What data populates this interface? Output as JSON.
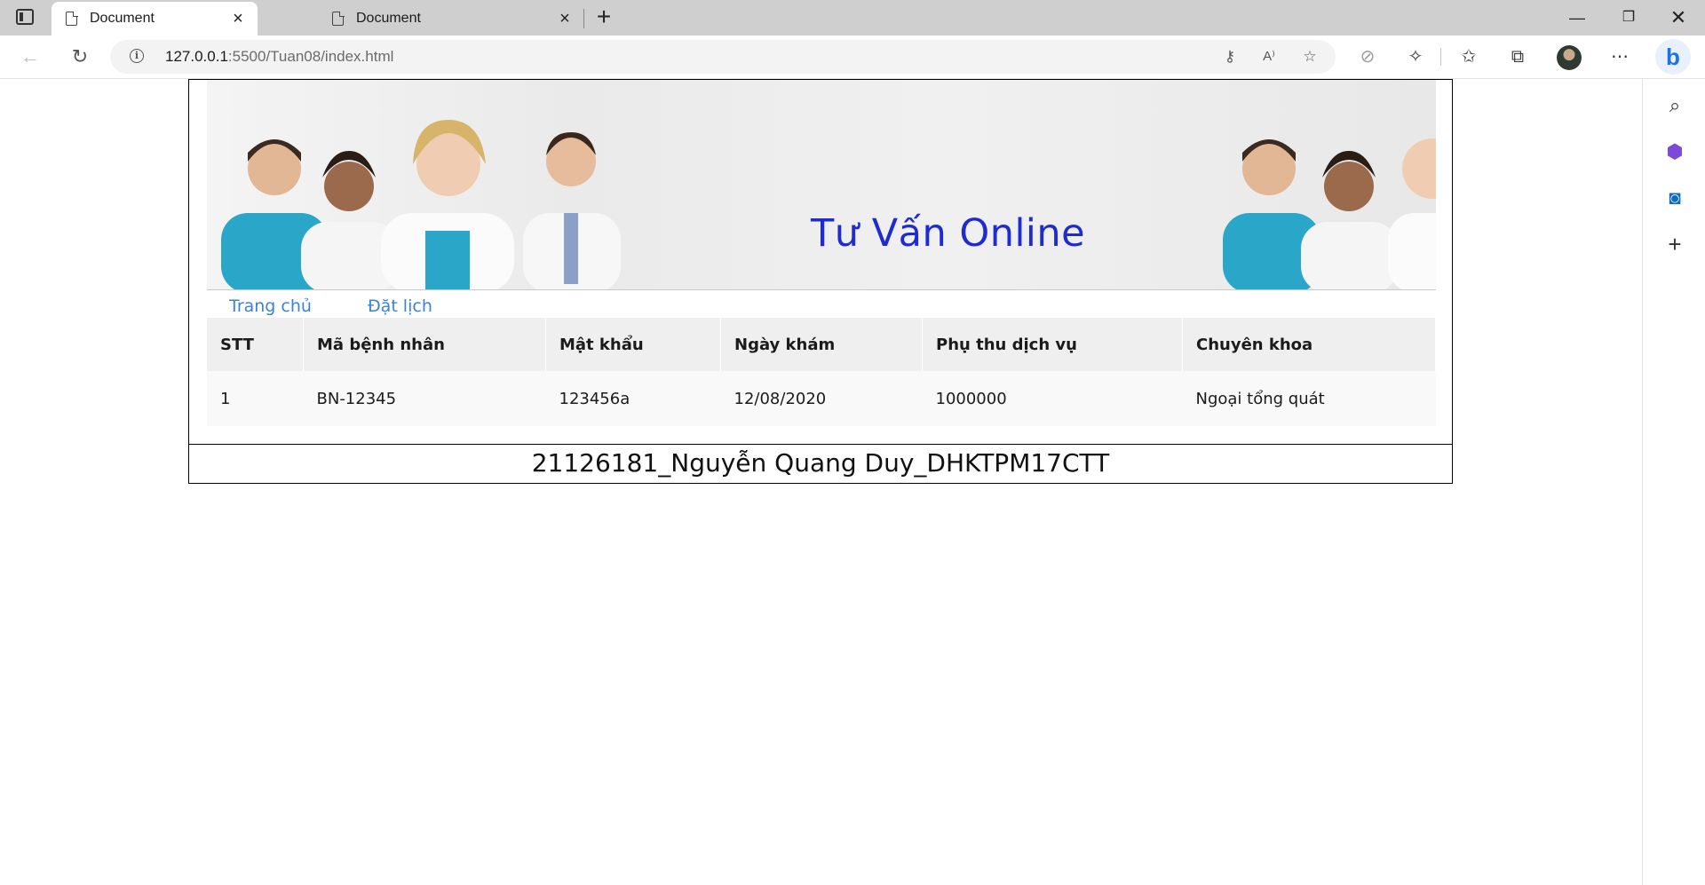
{
  "browser": {
    "tabs": [
      {
        "title": "Document",
        "active": true
      },
      {
        "title": "Document",
        "active": false
      }
    ],
    "url_host": "127.0.0.1",
    "url_path": ":5500/Tuan08/index.html",
    "icons": {
      "back": "arrow-left-icon",
      "refresh": "refresh-icon",
      "info": "info-icon",
      "key": "key-icon",
      "read_aloud": "read-aloud-icon",
      "favorite_add": "star-add-icon",
      "extensions": "puzzle-icon",
      "favorites": "favorites-icon",
      "collections": "collections-icon",
      "more": "more-icon",
      "bing": "bing-icon"
    },
    "sidebar_icons": [
      "search-icon",
      "copilot-icon",
      "outlook-icon",
      "add-icon"
    ]
  },
  "banner": {
    "title": "Tư Vấn Online"
  },
  "menu": [
    {
      "label": "Trang chủ"
    },
    {
      "label": "Đặt lịch"
    }
  ],
  "table": {
    "headers": [
      "STT",
      "Mã bệnh nhân",
      "Mật khẩu",
      "Ngày khám",
      "Phụ thu dịch vụ",
      "Chuyên khoa"
    ],
    "rows": [
      [
        "1",
        "BN-12345",
        "123456a",
        "12/08/2020",
        "1000000",
        "Ngoại tổng quát"
      ]
    ]
  },
  "footer": {
    "text": "21126181_Nguyễn Quang Duy_DHKTPM17CTT"
  },
  "colors": {
    "link": "#3b82d9",
    "banner_title": "#1d2bd0",
    "header_bg": "#efefef",
    "row_bg": "#f9f9f9"
  }
}
